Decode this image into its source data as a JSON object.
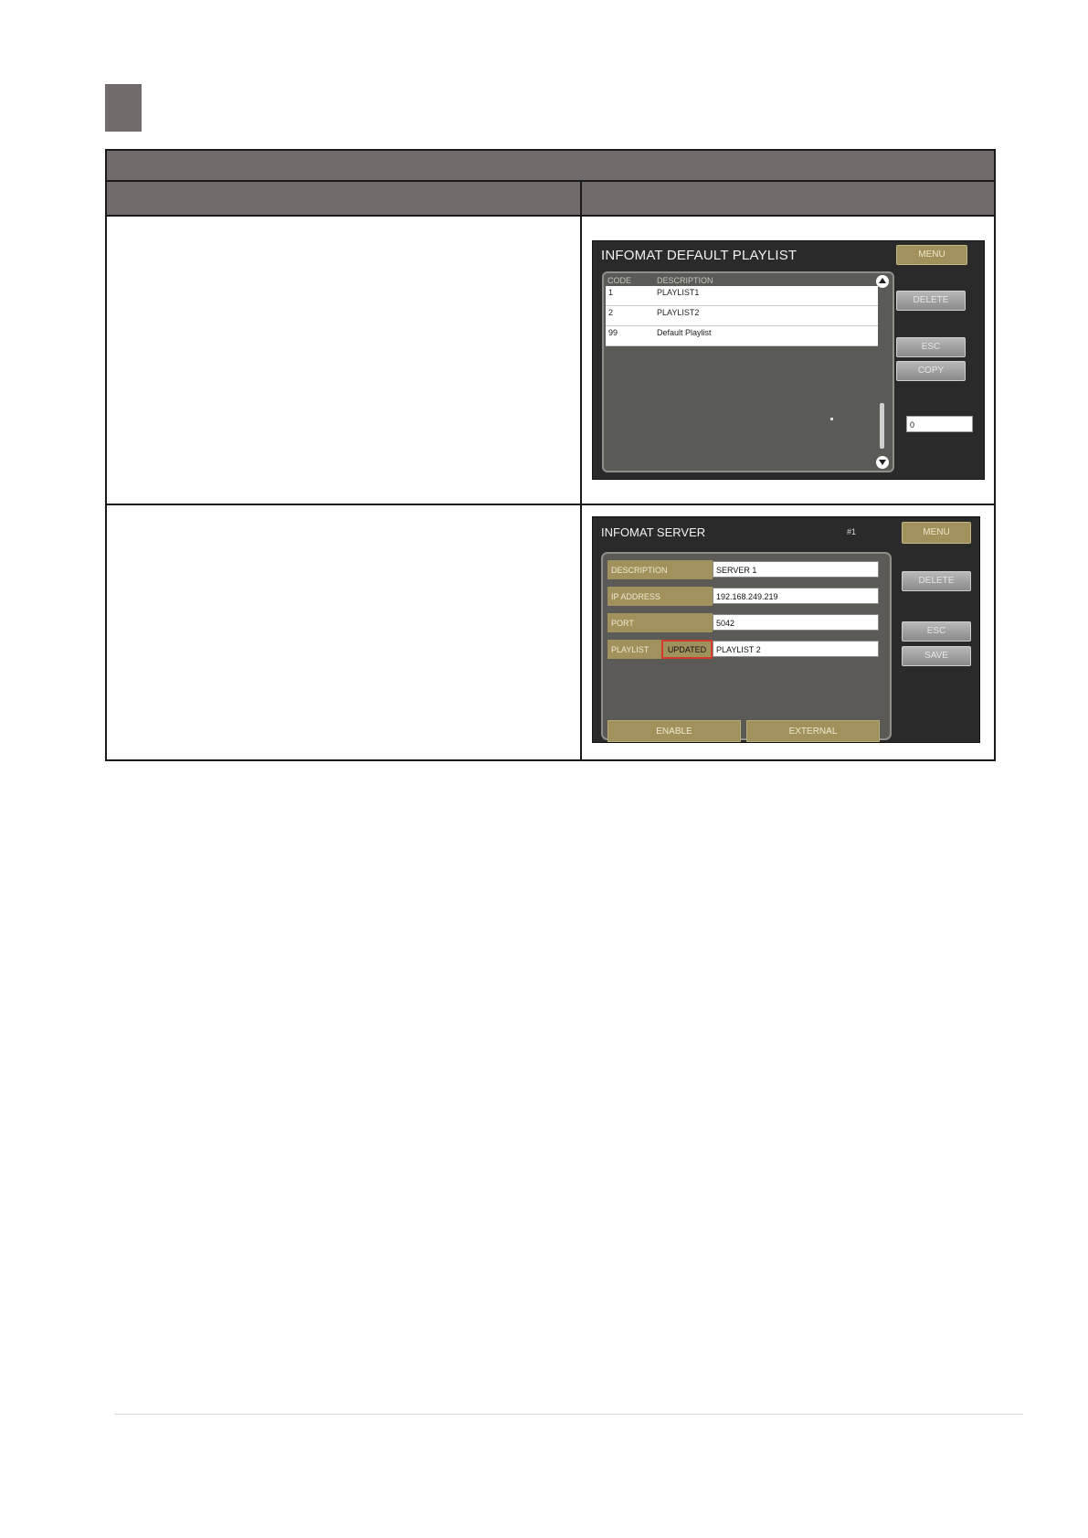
{
  "screen_playlist": {
    "title": "INFOMAT DEFAULT PLAYLIST",
    "buttons": {
      "menu": "MENU",
      "delete": "DELETE",
      "esc": "ESC",
      "copy": "COPY"
    },
    "columns": {
      "code": "CODE",
      "description": "DESCRIPTION"
    },
    "rows": [
      {
        "code": "1",
        "description": "PLAYLIST1"
      },
      {
        "code": "2",
        "description": "PLAYLIST2"
      },
      {
        "code": "99",
        "description": "Default Playlist"
      }
    ],
    "count_value": "0"
  },
  "screen_server": {
    "title": "INFOMAT SERVER",
    "record_number": "#1",
    "buttons": {
      "menu": "MENU",
      "delete": "DELETE",
      "esc": "ESC",
      "save": "SAVE",
      "enable": "ENABLE",
      "external": "EXTERNAL"
    },
    "fields": {
      "description": {
        "label": "DESCRIPTION",
        "value": "SERVER 1"
      },
      "ip_address": {
        "label": "IP ADDRESS",
        "value": "192.168.249.219"
      },
      "port": {
        "label": "PORT",
        "value": "5042"
      },
      "playlist": {
        "label": "PLAYLIST",
        "status": "UPDATED",
        "value": "PLAYLIST 2"
      }
    }
  }
}
